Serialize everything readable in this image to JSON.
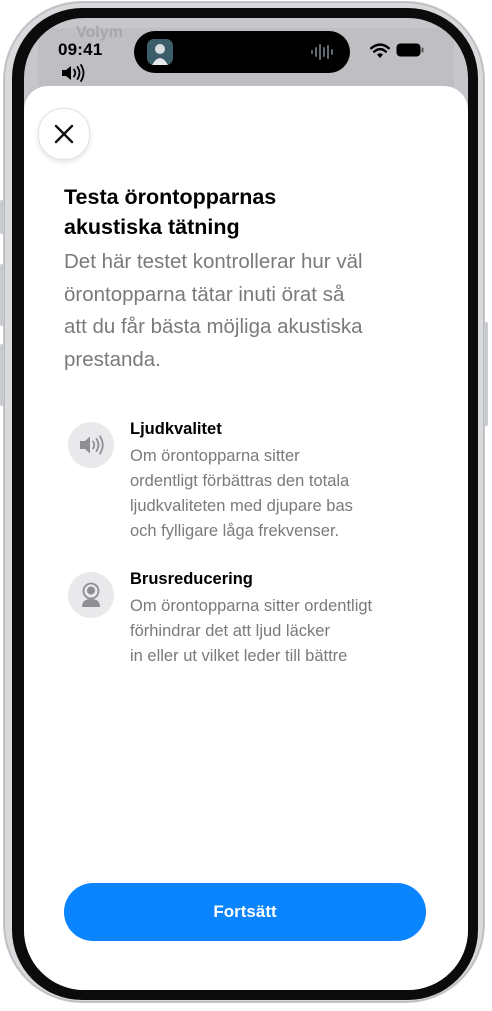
{
  "status_bar": {
    "time": "09:41",
    "background_app_title": "Volym"
  },
  "sheet": {
    "close_icon": "close-icon",
    "title": "Testa örontopparnas\nakustiska tätning",
    "subtitle": "Det här testet kontrollerar hur väl\nörontopparna tätar inuti örat så\natt du får bästa möjliga akustiska\nprestanda.",
    "features": [
      {
        "icon": "speaker-icon",
        "title": "Ljudkvalitet",
        "body": "Om örontopparna sitter\nordentligt förbättras den totala\nljudkvaliteten med djupare bas\noch fylligare låga frekvenser."
      },
      {
        "icon": "person-icon",
        "title": "Brusreducering",
        "body": "Om örontopparna sitter ordentligt\nförhindrar det att ljud läcker\nin eller ut vilket leder till bättre"
      }
    ],
    "continue_label": "Fortsätt"
  },
  "colors": {
    "accent": "#0a84ff",
    "secondary_text": "#7a7a7e",
    "icon_circle": "#e9e9ec"
  }
}
